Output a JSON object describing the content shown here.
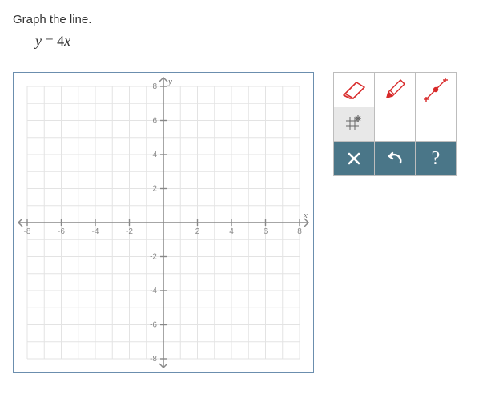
{
  "problem": {
    "instruction": "Graph the line.",
    "equation_lhs": "y",
    "equation_eq": " = ",
    "equation_coeff": "4",
    "equation_rhs": "x"
  },
  "graph": {
    "x_min": -8,
    "x_max": 8,
    "y_min": -8,
    "y_max": 8,
    "x_label": "x",
    "y_label": "y",
    "ticks": [
      -8,
      -6,
      -4,
      -2,
      2,
      4,
      6,
      8
    ]
  },
  "toolbar": {
    "eraser": "eraser-icon",
    "pencil": "pencil-icon",
    "point": "point-icon",
    "grid": "grid-icon",
    "clear": "clear-icon",
    "undo": "undo-icon",
    "help_label": "?"
  }
}
